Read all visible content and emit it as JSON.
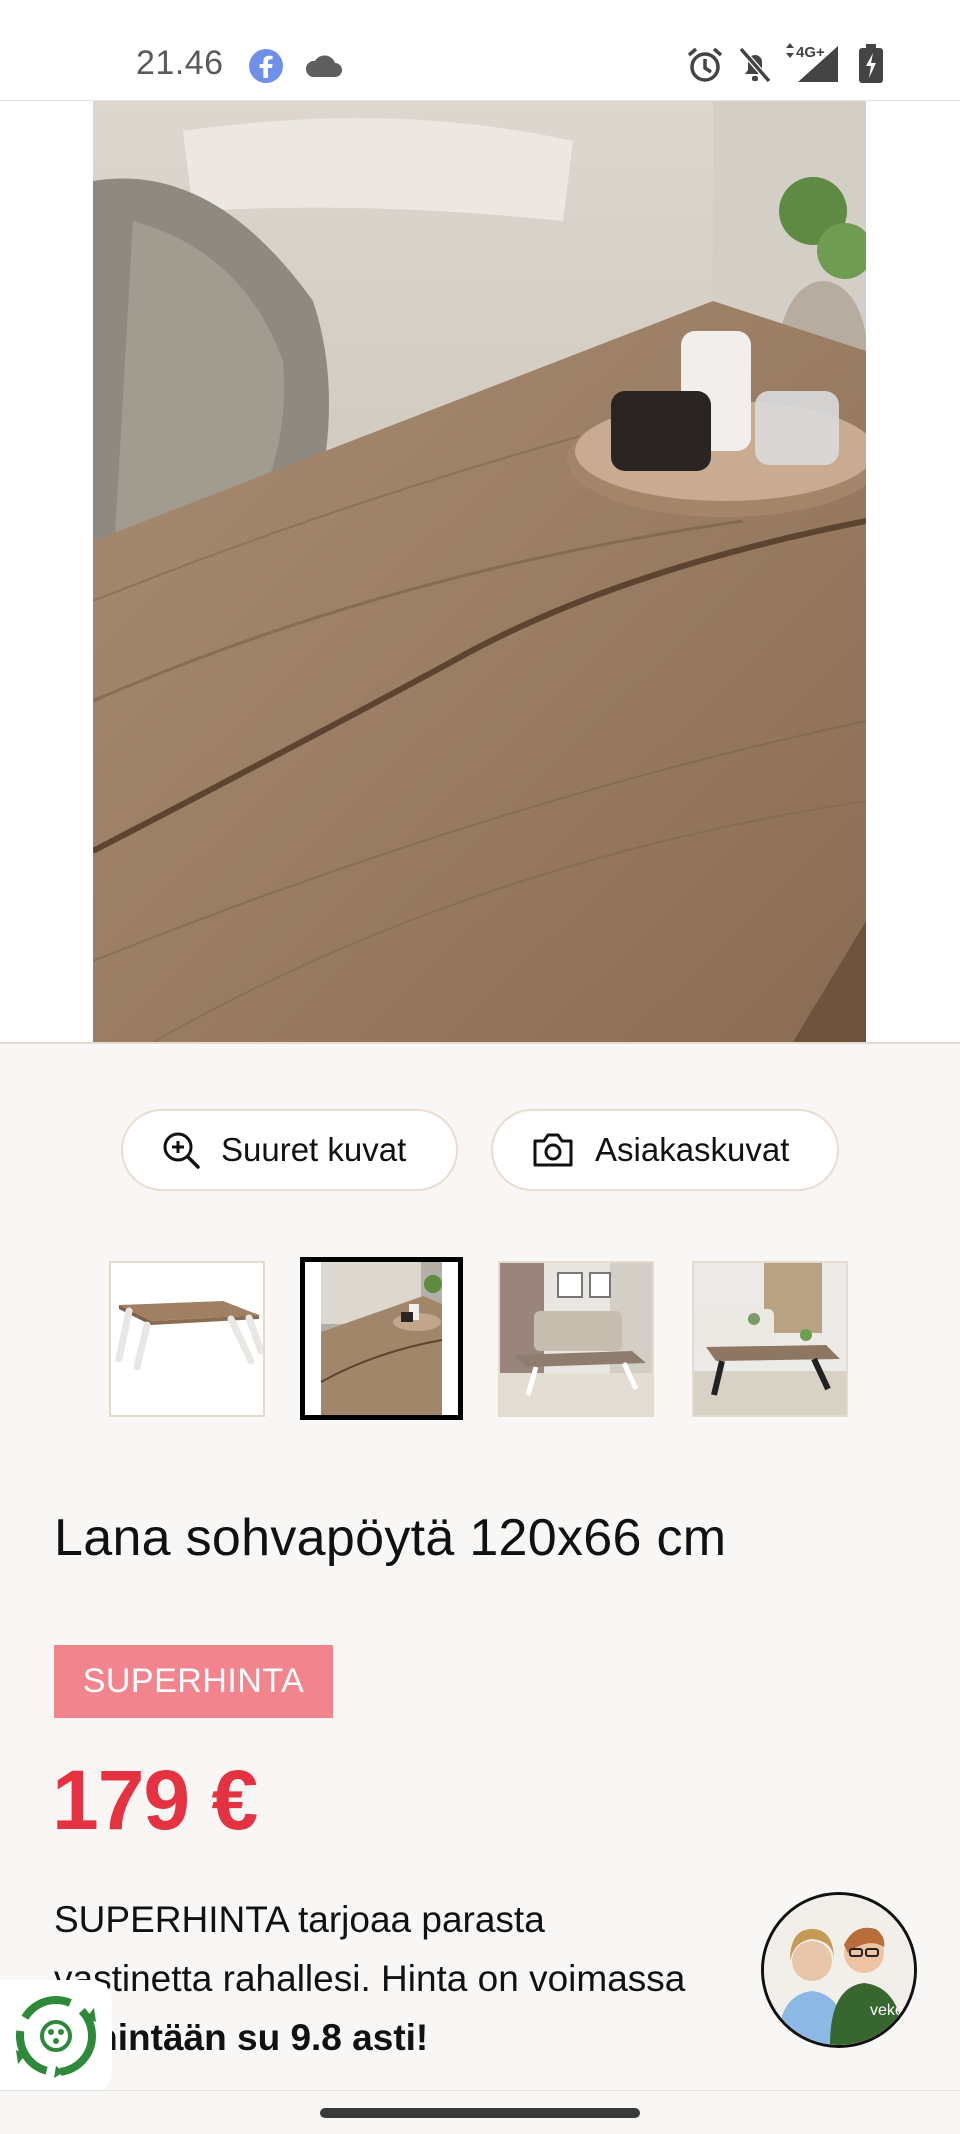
{
  "status_bar": {
    "time": "21.46",
    "icons": [
      "facebook-icon",
      "cloud-icon",
      "alarm-icon",
      "notifications-off-icon",
      "signal-4g-icon",
      "battery-charging-icon"
    ],
    "network_label": "4G+"
  },
  "gallery": {
    "buttons": {
      "large_images": "Suuret kuvat",
      "customer_images": "Asiakaskuvat"
    },
    "thumbnails_count": 4,
    "active_thumbnail": 2
  },
  "product": {
    "title": "Lana sohvapöytä 120x66 cm",
    "badge": "SUPERHINTA",
    "price": "179 €",
    "description_lead": "SUPERHINTA tarjoaa parasta vastinetta rahallesi. Hinta on voimassa ",
    "description_bold": "vähintään su 9.8 asti!"
  },
  "colors": {
    "price": "#e53241",
    "badge_bg": "#f2848d",
    "page_bg": "#f8f7f5"
  }
}
